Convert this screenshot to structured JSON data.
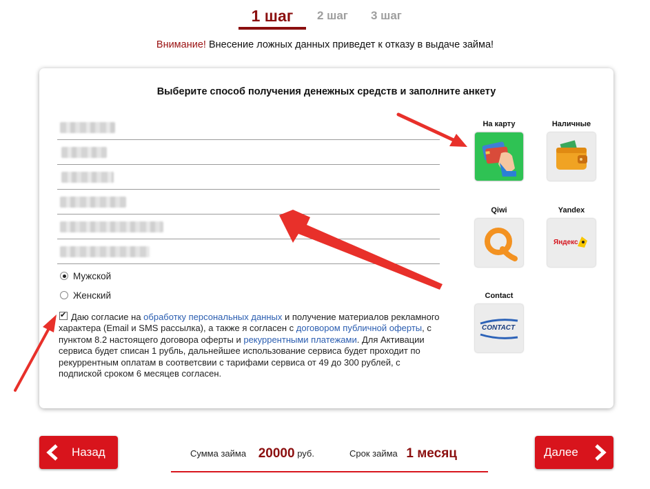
{
  "steps": {
    "step1": "1 шаг",
    "step2": "2 шаг",
    "step3": "3 шаг"
  },
  "warning": {
    "prefix": "Внимание!",
    "text": " Внесение ложных данных приведет к отказу в выдаче займа!"
  },
  "form": {
    "title": "Выберите способ получения денежных средств и заполните анкету",
    "gender_male": "Мужской",
    "gender_female": "Женский",
    "consent": {
      "t1": "Даю согласие на ",
      "link1": "обработку персональных данных",
      "t2": " и получение материалов рекламного характера (Email и SMS рассылка), а также я согласен с ",
      "link2": "договором публичной оферты",
      "t3": ", с пунктом 8.2 настоящего договора оферты и ",
      "link3": "рекуррентными платежами",
      "t4": ". Для Активации сервиса будет списан 1 рубль, дальнейшее использование сервиса будет проходит по рекуррентным оплатам в соответсвии с тарифами сервиса от 49 до 300 рублей, с подпиской сроком 6 месяцев согласен."
    }
  },
  "payment_methods": {
    "card": "На карту",
    "cash": "Наличные",
    "qiwi": "Qiwi",
    "yandex": "Yandex",
    "yandex_logo": "Яндекс",
    "contact": "Contact",
    "contact_logo": "CONTACT"
  },
  "bottom": {
    "back": "Назад",
    "next": "Далее",
    "sum_label": "Сумма займа",
    "sum_value": "20000",
    "sum_unit": "руб.",
    "term_label": "Срок займа",
    "term_value": "1 месяц"
  },
  "colors": {
    "accent_dark_red": "#8b0f0f",
    "button_red": "#d8141c",
    "card_green": "#2fc254",
    "link_blue": "#2a5db0"
  }
}
